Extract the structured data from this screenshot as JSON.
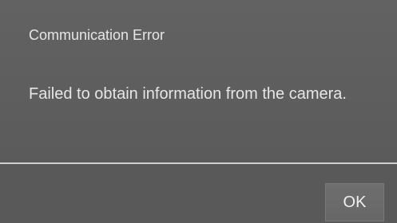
{
  "dialog": {
    "title": "Communication Error",
    "message": "Failed to obtain information from the camera.",
    "ok_label": "OK"
  },
  "colors": {
    "background": "#5d5d5d",
    "text": "#e6e6e6",
    "divider": "#cfcfcf"
  }
}
